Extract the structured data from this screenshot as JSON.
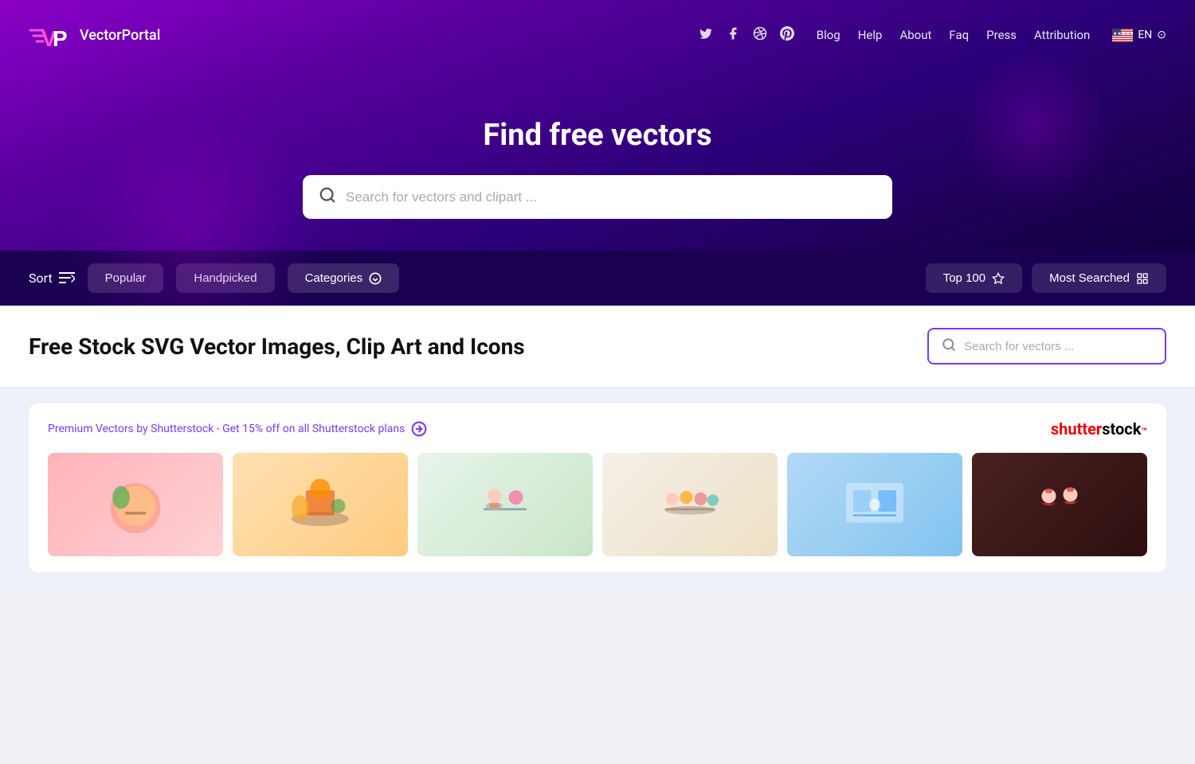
{
  "logo": {
    "text": "VectorPortal",
    "icon_label": "vp-logo-icon"
  },
  "social": {
    "icons": [
      {
        "name": "twitter-icon",
        "symbol": "𝕏"
      },
      {
        "name": "facebook-icon",
        "symbol": "f"
      },
      {
        "name": "dribbble-icon",
        "symbol": "⊙"
      },
      {
        "name": "pinterest-icon",
        "symbol": "P"
      }
    ]
  },
  "nav": {
    "links": [
      {
        "label": "Blog",
        "name": "nav-blog"
      },
      {
        "label": "Help",
        "name": "nav-help"
      },
      {
        "label": "About",
        "name": "nav-about"
      },
      {
        "label": "Faq",
        "name": "nav-faq"
      },
      {
        "label": "Press",
        "name": "nav-press"
      },
      {
        "label": "Attribution",
        "name": "nav-attribution"
      }
    ],
    "lang": "EN"
  },
  "hero": {
    "title": "Find free vectors",
    "search_placeholder": "Search for vectors and clipart ..."
  },
  "filter": {
    "sort_label": "Sort",
    "buttons": [
      {
        "label": "Popular",
        "name": "filter-popular"
      },
      {
        "label": "Handpicked",
        "name": "filter-handpicked"
      },
      {
        "label": "Categories",
        "name": "filter-categories"
      }
    ],
    "right_buttons": [
      {
        "label": "Top 100",
        "name": "filter-top100",
        "icon": "★"
      },
      {
        "label": "Most Searched",
        "name": "filter-most-searched",
        "icon": "▦"
      }
    ]
  },
  "main": {
    "section_title": "Free Stock SVG Vector Images, Clip Art and Icons",
    "search_placeholder": "Search for vectors ..."
  },
  "shutterstock": {
    "promo_text": "Premium Vectors by Shutterstock - Get 15% off on all Shutterstock plans",
    "promo_icon": "→",
    "logo_text_red": "shutter",
    "logo_text_black": "stock",
    "logo_suffix": "™"
  }
}
